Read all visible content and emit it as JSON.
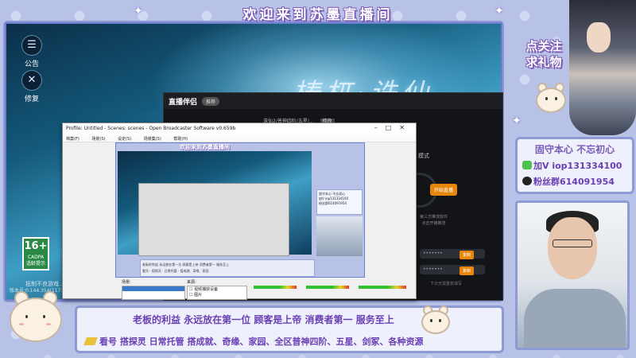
{
  "banner": {
    "title": "欢迎来到苏墨直播间"
  },
  "game": {
    "sidebar": [
      {
        "label": "公告",
        "icon": "announcement-icon"
      },
      {
        "label": "修复",
        "icon": "repair-icon"
      }
    ],
    "logo_text": "梼杌·诛仙",
    "age_rating": {
      "value": "16+",
      "caption": "CADPA",
      "label": "适龄提示"
    },
    "health_tip": "抵制不良游戏...",
    "version": "版本号:0.144.354(1173..."
  },
  "stream_app": {
    "logo": "直播伴侣",
    "logo_pill": "推荐",
    "breadcrumb": "诛仙2/普神四阶/五星/...",
    "breadcrumb_tag": "修改",
    "mode_label": "模式",
    "start_button": "开始直播",
    "description": "第三方推流软件\n点击开播推流",
    "stream_key_placeholder": "•••••••",
    "copy_label": "复制",
    "hint": "下次无需重复填写"
  },
  "obs": {
    "title": "Profile: Untitled - Scenes: scenes - Open Broadcaster Software v0.659b",
    "menu": [
      "档案(F)",
      "场景(S)",
      "设定(S)",
      "场景集(S)",
      "帮助(H)"
    ],
    "scenes_label": "场景:",
    "sources_label": "来源:",
    "sources": [
      "视频捕获设备",
      "图片"
    ],
    "nested_top": "老板的利益 永远放在第一位 顾客是上帝 消费者第一 服务至上",
    "nested_bottom": "看号 · 搭探灵 · 日常托管 · 搭成就、奇缘、家园"
  },
  "right": {
    "follow_line1": "点关注",
    "follow_line2": "求礼物",
    "promo_line1": "固守本心 不忘初心",
    "promo_wechat": "加V iop131334100",
    "promo_qq": "粉丝群614091954"
  },
  "bottom": {
    "line1": "老板的利益 永远放在第一位 顾客是上帝 消费者第一 服务至上",
    "line2": "看号  搭探灵 日常托管  搭成就、奇缘、家园、全区普神四阶、五星、剑冢、各种资源"
  },
  "colors": {
    "accent_purple": "#6a3fb5",
    "border_lavender": "#8e9ad4",
    "orange": "#e8860c"
  }
}
